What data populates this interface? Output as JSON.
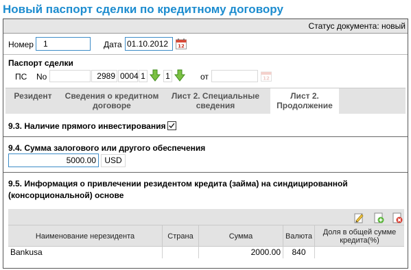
{
  "page": {
    "title": "Новый паспорт сделки по кредитному договору"
  },
  "status": {
    "text": "Статус документа: новый"
  },
  "doc": {
    "number_label": "Номер",
    "number_value": "1",
    "date_label": "Дата",
    "date_value": "01.10.2012"
  },
  "passport": {
    "heading": "Паспорт сделки",
    "ps_label": "ПС",
    "no_label": "No",
    "part1": "",
    "part2": "2989",
    "part3": "0004",
    "part4": "1",
    "part5": "1",
    "from_label": "от",
    "from_value": ""
  },
  "tabs": [
    {
      "label": "Резидент"
    },
    {
      "label": "Сведения о кредитном договоре"
    },
    {
      "label": "Лист 2. Специальные сведения"
    },
    {
      "label": "Лист 2. Продолжение"
    }
  ],
  "sections": {
    "s93": {
      "title": "9.3. Наличие прямого инвестирования",
      "checked": true
    },
    "s94": {
      "title": "9.4. Сумма залогового или другого обеспечения",
      "amount": "5000.00",
      "currency": "USD"
    },
    "s95": {
      "title": "9.5. Информация о привлечении резидентом кредита (займа) на синдицированной (консорциональной) основе"
    }
  },
  "grid": {
    "columns": [
      "Наименование нерезидента",
      "Страна",
      "Сумма",
      "Валюта",
      "Доля в общей сумме кредита(%)"
    ],
    "rows": [
      [
        "Bankusa",
        "",
        "2000.00",
        "840",
        ""
      ]
    ]
  },
  "icons": {
    "calendar": "calendar-icon",
    "arrow": "green-down-arrow-icon",
    "edit": "edit-icon",
    "add": "add-icon",
    "delete": "delete-icon"
  }
}
